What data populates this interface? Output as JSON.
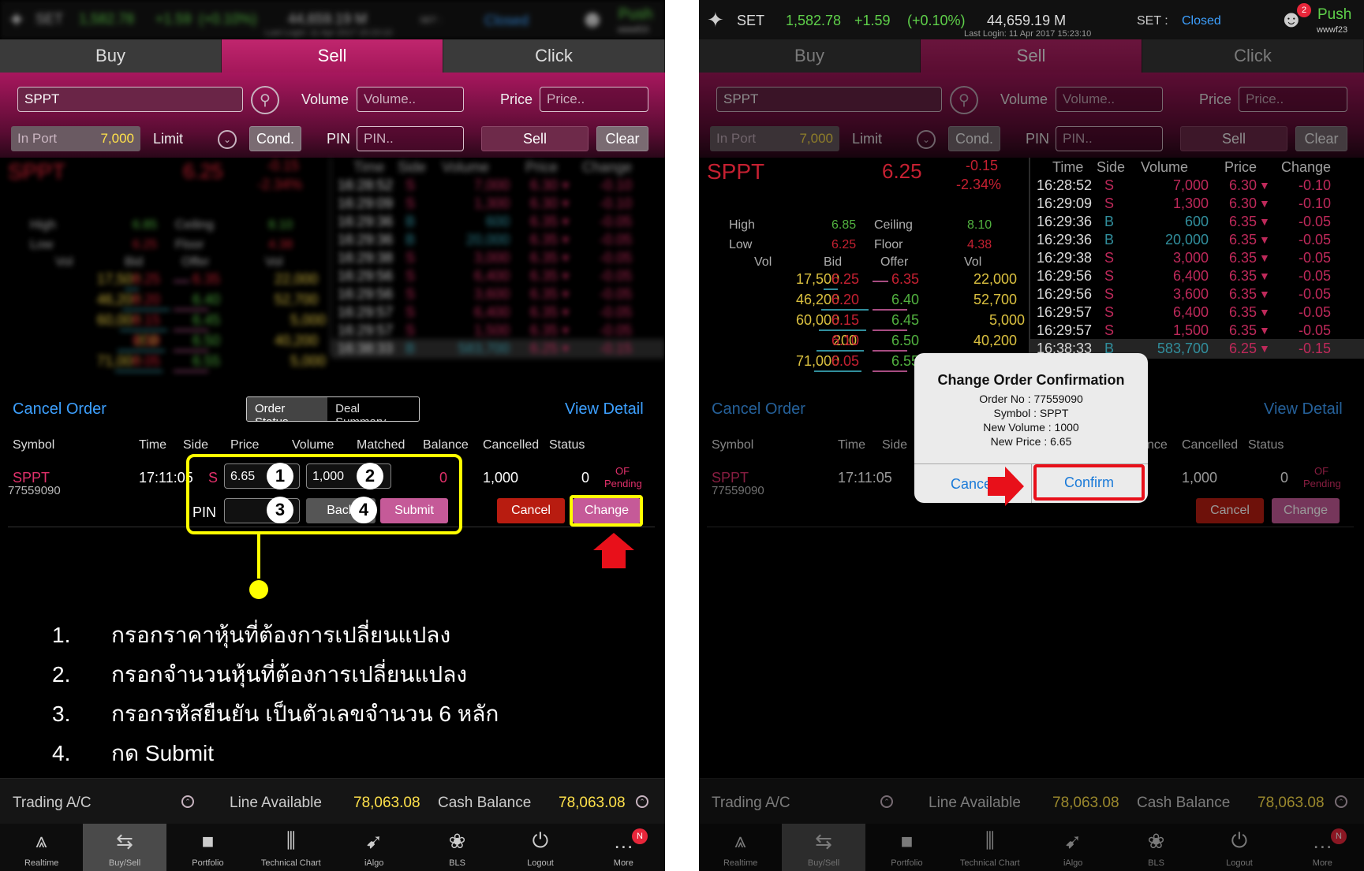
{
  "header": {
    "exchange": "SET",
    "index": "1,582.78",
    "change": "+1.59",
    "change_pct": "(+0.10%)",
    "value": "44,659.19 M",
    "last_login": "Last Login: 11 Apr 2017 15:23:10",
    "market_label": "SET :",
    "market_status": "Closed",
    "push_label": "Push",
    "user": "wwwf23",
    "notif_count": "2"
  },
  "tabs": [
    "Buy",
    "Sell",
    "Click"
  ],
  "form": {
    "symbol": "SPPT",
    "volume_label": "Volume",
    "volume_placeholder": "Volume..",
    "price_label": "Price",
    "price_placeholder": "Price..",
    "inport_label": "In Port",
    "inport_value": "7,000",
    "limit_label": "Limit",
    "cond_label": "Cond.",
    "pin_label": "PIN",
    "pin_placeholder": "PIN..",
    "sell_label": "Sell",
    "clear_label": "Clear"
  },
  "quote": {
    "symbol": "SPPT",
    "last": "6.25",
    "chg": "-0.15",
    "chg_pct": "-2.34%",
    "high_label": "High",
    "high": "6.85",
    "ceiling_label": "Ceiling",
    "ceiling": "8.10",
    "low_label": "Low",
    "low": "6.25",
    "floor_label": "Floor",
    "floor": "4.38",
    "book_headers": [
      "Vol",
      "Bid",
      "Offer",
      "Vol"
    ],
    "book": [
      {
        "bidvol": "17,500",
        "bid": "6.25",
        "offer": "6.35",
        "offervol": "22,000"
      },
      {
        "bidvol": "46,200",
        "bid": "6.20",
        "offer": "6.40",
        "offervol": "52,700"
      },
      {
        "bidvol": "60,000",
        "bid": "6.15",
        "offer": "6.45",
        "offervol": "5,000"
      },
      {
        "bidvol": "200",
        "bid": "6.10",
        "offer": "6.50",
        "offervol": "40,200"
      },
      {
        "bidvol": "71,000",
        "bid": "6.05",
        "offer": "6.55",
        "offervol": "5,000"
      }
    ]
  },
  "trades": {
    "headers": [
      "Time",
      "Side",
      "Volume",
      "Price",
      "Change"
    ],
    "rows": [
      {
        "time": "16:28:52",
        "side": "S",
        "volume": "7,000",
        "price": "6.30",
        "change": "-0.10"
      },
      {
        "time": "16:29:09",
        "side": "S",
        "volume": "1,300",
        "price": "6.30",
        "change": "-0.10"
      },
      {
        "time": "16:29:36",
        "side": "B",
        "volume": "600",
        "price": "6.35",
        "change": "-0.05"
      },
      {
        "time": "16:29:36",
        "side": "B",
        "volume": "20,000",
        "price": "6.35",
        "change": "-0.05"
      },
      {
        "time": "16:29:38",
        "side": "S",
        "volume": "3,000",
        "price": "6.35",
        "change": "-0.05"
      },
      {
        "time": "16:29:56",
        "side": "S",
        "volume": "6,400",
        "price": "6.35",
        "change": "-0.05"
      },
      {
        "time": "16:29:56",
        "side": "S",
        "volume": "3,600",
        "price": "6.35",
        "change": "-0.05"
      },
      {
        "time": "16:29:57",
        "side": "S",
        "volume": "6,400",
        "price": "6.35",
        "change": "-0.05"
      },
      {
        "time": "16:29:57",
        "side": "S",
        "volume": "1,500",
        "price": "6.35",
        "change": "-0.05"
      },
      {
        "time": "16:38:33",
        "side": "B",
        "volume": "583,700",
        "price": "6.25",
        "change": "-0.15"
      }
    ]
  },
  "orders": {
    "cancel_order": "Cancel Order",
    "order_status": "Order Status",
    "deal_summary": "Deal Summary",
    "view_detail": "View Detail",
    "cols": [
      "Symbol",
      "Time",
      "Side",
      "Price",
      "Volume",
      "Matched",
      "Balance",
      "Cancelled",
      "Status"
    ],
    "row": {
      "symbol": "SPPT",
      "order_no": "77559090",
      "time": "17:11:05",
      "side": "S",
      "price": "6.65",
      "volume": "1,000",
      "matched": "0",
      "balance": "1,000",
      "cancelled": "0",
      "status_1": "OF",
      "status_2": "Pending"
    },
    "pin_label": "PIN",
    "back_label": "Back",
    "submit_label": "Submit",
    "cancel_btn": "Cancel",
    "change_btn": "Change"
  },
  "instructions": [
    {
      "n": "1.",
      "text": "กรอกราคาหุ้นที่ต้องการเปลี่ยนแปลง"
    },
    {
      "n": "2.",
      "text": "กรอกจำนวนหุ้นที่ต้องการเปลี่ยนแปลง"
    },
    {
      "n": "3.",
      "text": "กรอกรหัสยืนยัน เป็นตัวเลขจำนวน 6 หลัก"
    },
    {
      "n": "4.",
      "text": "กด Submit"
    }
  ],
  "markers": [
    "1",
    "2",
    "3",
    "4"
  ],
  "account": {
    "trading_label": "Trading A/C",
    "line_label": "Line Available",
    "line_value": "78,063.08",
    "cash_label": "Cash Balance",
    "cash_value": "78,063.08"
  },
  "nav": [
    {
      "label": "Realtime",
      "icon": "realtime-icon"
    },
    {
      "label": "Buy/Sell",
      "icon": "buysell-icon"
    },
    {
      "label": "Portfolio",
      "icon": "portfolio-icon"
    },
    {
      "label": "Technical Chart",
      "icon": "chart-icon"
    },
    {
      "label": "iAlgo",
      "icon": "ialgo-icon"
    },
    {
      "label": "BLS",
      "icon": "bls-icon"
    },
    {
      "label": "Logout",
      "icon": "power-icon"
    },
    {
      "label": "More",
      "icon": "more-icon"
    }
  ],
  "more_badge": "N",
  "dialog": {
    "title": "Change Order Confirmation",
    "order_no": "Order No : 77559090",
    "symbol": "Symbol : SPPT",
    "new_volume": "New Volume : 1000",
    "new_price": "New Price : 6.65",
    "cancel": "Cancel",
    "confirm": "Confirm"
  },
  "colors": {
    "accent": "#b0195f",
    "up": "#5fd04a",
    "down": "#e8263a",
    "yellow": "#ffe14a",
    "blue_link": "#3da0ff",
    "highlight": "#ffff00"
  }
}
